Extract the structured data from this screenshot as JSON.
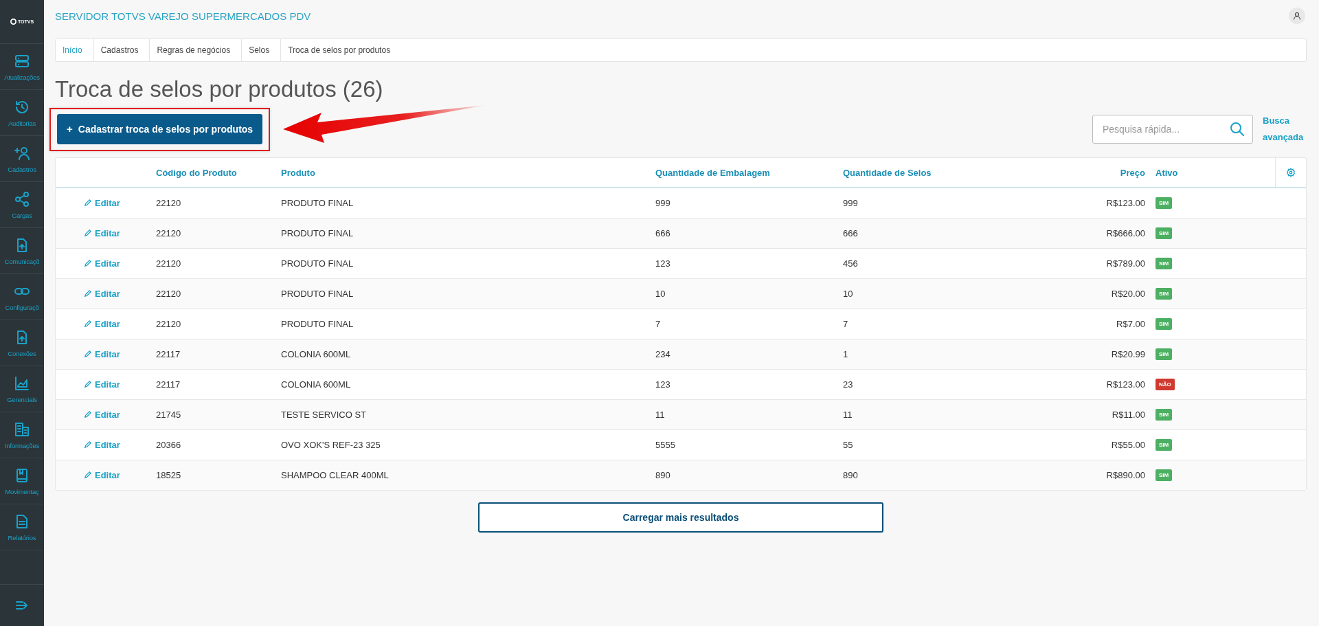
{
  "sidebar": {
    "logo": "TOTVS",
    "items": [
      {
        "kind": "server",
        "label": "Atualizações"
      },
      {
        "kind": "history",
        "label": "Auditorias"
      },
      {
        "kind": "user-add",
        "label": "Cadastros"
      },
      {
        "kind": "share",
        "label": "Cargas"
      },
      {
        "kind": "file-up",
        "label": "Comunicaçõ"
      },
      {
        "kind": "link",
        "label": "Configuraçõ"
      },
      {
        "kind": "file-up",
        "label": "Conexões"
      },
      {
        "kind": "chart",
        "label": "Gerenciais"
      },
      {
        "kind": "building",
        "label": "Informações"
      },
      {
        "kind": "book",
        "label": "Movimentaç"
      },
      {
        "kind": "doc",
        "label": "Relatórios"
      }
    ]
  },
  "header": {
    "title": "SERVIDOR TOTVS VAREJO SUPERMERCADOS PDV"
  },
  "breadcrumb": [
    {
      "label": "Início",
      "link": true
    },
    {
      "label": "Cadastros",
      "link": false
    },
    {
      "label": "Regras de negócios",
      "link": false
    },
    {
      "label": "Selos",
      "link": false
    },
    {
      "label": "Troca de selos por produtos",
      "link": false
    }
  ],
  "page_title": "Troca de selos por produtos (26)",
  "new_button": {
    "icon": "+",
    "label": "Cadastrar troca de selos por produtos"
  },
  "search": {
    "placeholder": "Pesquisa rápida..."
  },
  "advanced_search": "Busca avançada",
  "table": {
    "columns": [
      "Código do Produto",
      "Produto",
      "Quantidade de Embalagem",
      "Quantidade de Selos",
      "Preço",
      "Ativo"
    ],
    "rows": [
      {
        "edit": "Editar",
        "code": "22120",
        "product": "PRODUTO FINAL",
        "pack_qty": "999",
        "seal_qty": "999",
        "price": "R$123.00",
        "active": true,
        "status": "SIM"
      },
      {
        "edit": "Editar",
        "code": "22120",
        "product": "PRODUTO FINAL",
        "pack_qty": "666",
        "seal_qty": "666",
        "price": "R$666.00",
        "active": true,
        "status": "SIM"
      },
      {
        "edit": "Editar",
        "code": "22120",
        "product": "PRODUTO FINAL",
        "pack_qty": "123",
        "seal_qty": "456",
        "price": "R$789.00",
        "active": true,
        "status": "SIM"
      },
      {
        "edit": "Editar",
        "code": "22120",
        "product": "PRODUTO FINAL",
        "pack_qty": "10",
        "seal_qty": "10",
        "price": "R$20.00",
        "active": true,
        "status": "SIM"
      },
      {
        "edit": "Editar",
        "code": "22120",
        "product": "PRODUTO FINAL",
        "pack_qty": "7",
        "seal_qty": "7",
        "price": "R$7.00",
        "active": true,
        "status": "SIM"
      },
      {
        "edit": "Editar",
        "code": "22117",
        "product": "COLONIA 600ML",
        "pack_qty": "234",
        "seal_qty": "1",
        "price": "R$20.99",
        "active": true,
        "status": "SIM"
      },
      {
        "edit": "Editar",
        "code": "22117",
        "product": "COLONIA 600ML",
        "pack_qty": "123",
        "seal_qty": "23",
        "price": "R$123.00",
        "active": false,
        "status": "NÃO"
      },
      {
        "edit": "Editar",
        "code": "21745",
        "product": "TESTE SERVICO ST",
        "pack_qty": "11",
        "seal_qty": "11",
        "price": "R$11.00",
        "active": true,
        "status": "SIM"
      },
      {
        "edit": "Editar",
        "code": "20366",
        "product": "OVO XOK'S REF-23 325",
        "pack_qty": "5555",
        "seal_qty": "55",
        "price": "R$55.00",
        "active": true,
        "status": "SIM"
      },
      {
        "edit": "Editar",
        "code": "18525",
        "product": "SHAMPOO CLEAR 400ML",
        "pack_qty": "890",
        "seal_qty": "890",
        "price": "R$890.00",
        "active": true,
        "status": "SIM"
      }
    ]
  },
  "load_more": "Carregar mais resultados"
}
